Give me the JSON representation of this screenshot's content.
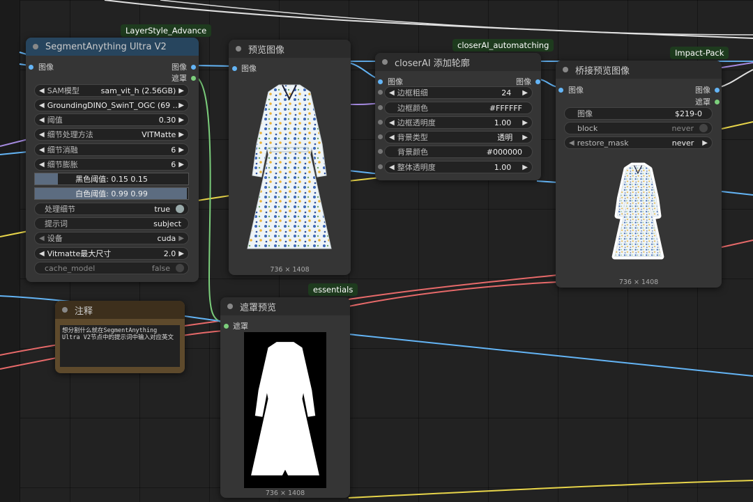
{
  "nodes": {
    "segment": {
      "title": "SegmentAnything Ultra V2",
      "badge": "LayerStyle_Advance",
      "in_image": "图像",
      "out_image": "图像",
      "out_mask": "遮罩",
      "widgets": [
        {
          "label": "SAM模型",
          "value": "sam_vit_h (2.56GB)"
        },
        {
          "label": "GroundingDINO_SwinT_OGC (69 ...",
          "value": ""
        },
        {
          "label": "阈值",
          "value": "0.30"
        },
        {
          "label": "细节处理方法",
          "value": "VITMatte"
        },
        {
          "label": "细节消融",
          "value": "6"
        },
        {
          "label": "细节膨胀",
          "value": "6"
        }
      ],
      "slider_black": {
        "label": "黑色阈值: 0.15  0.15",
        "fill": 0.15
      },
      "slider_white": {
        "label": "白色阈值: 0.99  0.99",
        "fill": 0.99
      },
      "toggle_detail": {
        "label": "处理细节",
        "value": "true"
      },
      "prompt": {
        "label": "提示词",
        "value": "subject"
      },
      "device": {
        "label": "设备",
        "value": "cuda"
      },
      "vitmatte": {
        "label": "Vitmatte最大尺寸",
        "value": "2.0"
      },
      "cache": {
        "label": "cache_model",
        "value": "false"
      }
    },
    "preview": {
      "title": "预览图像",
      "in_image": "图像",
      "dims": "736 × 1408"
    },
    "closer": {
      "title": "closerAI 添加轮廓",
      "badge": "closerAI_automatching",
      "in_image": "图像",
      "out_image": "图像",
      "widgets": [
        {
          "label": "边框粗细",
          "value": "24"
        },
        {
          "label": "边框颜色",
          "value": "#FFFFFF"
        },
        {
          "label": "边框透明度",
          "value": "1.00"
        },
        {
          "label": "背景类型",
          "value": "透明"
        },
        {
          "label": "背景颜色",
          "value": "#000000"
        },
        {
          "label": "整体透明度",
          "value": "1.00"
        }
      ]
    },
    "bridge": {
      "title": "桥接预览图像",
      "badge": "Impact-Pack",
      "in_image": "图像",
      "out_image": "图像",
      "out_mask": "遮罩",
      "image_widget": {
        "label": "图像",
        "value": "$219-0"
      },
      "block": {
        "label": "block",
        "value": "never"
      },
      "restore": {
        "label": "restore_mask",
        "value": "never"
      },
      "dims": "736 × 1408"
    },
    "note": {
      "title": "注释",
      "text": "想分割什么就在SegmentAnything Ultra V2节点中的提示词中输入对应英文"
    },
    "maskpreview": {
      "title": "遮罩预览",
      "badge": "essentials",
      "in_mask": "遮罩",
      "dims": "736 × 1408"
    }
  },
  "colors": {
    "image_wire": "#64b5f6",
    "mask_wire": "#7ccf7c",
    "red_wire": "#e86a6a",
    "yellow_wire": "#e8d54a",
    "purple_wire": "#a58ae0",
    "header_blue": "#27455e",
    "note_brown": "#5e4a2c"
  }
}
